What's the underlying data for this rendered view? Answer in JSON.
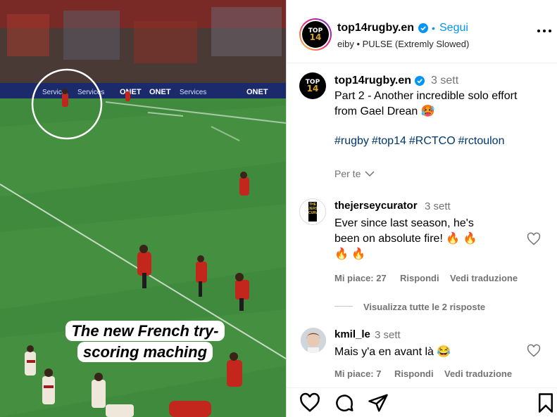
{
  "video": {
    "caption_line1": "The new French try-",
    "caption_line2": "scoring maching",
    "board_texts": [
      "Service",
      "Services",
      "ONET",
      "ONET",
      "Services",
      "ONET"
    ]
  },
  "header": {
    "username": "top14rugby.en",
    "separator": "•",
    "follow_label": "Segui",
    "audio_line": "eiby • PULSE (Extremly Slowed)"
  },
  "post": {
    "username": "top14rugby.en",
    "time": "3 sett",
    "caption_line1": "Part 2 - Another incredible solo effort",
    "caption_line2": "from Gael Drean 🥵",
    "hashtags": [
      "#rugby",
      "#top14",
      "#RCTCO",
      "#rctoulon"
    ],
    "translate_label": "Per te"
  },
  "logo": {
    "top": "TOP",
    "num": "14"
  },
  "comments": [
    {
      "username": "thejerseycurator",
      "time": "3 sett",
      "line1": "Ever since last season, he's",
      "line2": "been on absolute fire! 🔥 🔥",
      "line3": "🔥 🔥",
      "likes_label": "Mi piace: 27",
      "reply_label": "Rispondi",
      "translate_label": "Vedi traduzione",
      "avatar_text": "THE JERSEY CURATOR"
    },
    {
      "username": "kmil_le",
      "time": "3 sett",
      "line1": "Mais y'a en avant là 😂",
      "likes_label": "Mi piace: 7",
      "reply_label": "Rispondi",
      "translate_label": "Vedi traduzione"
    }
  ],
  "view_replies_label": "Visualizza tutte le 2 risposte",
  "colors": {
    "accent": "#0095f6",
    "hashtag": "#00376b",
    "muted": "#737373"
  },
  "icons": [
    "more-options-icon",
    "verified-icon",
    "heart-icon",
    "comment-icon",
    "share-icon",
    "bookmark-icon",
    "chevron-down-icon"
  ]
}
